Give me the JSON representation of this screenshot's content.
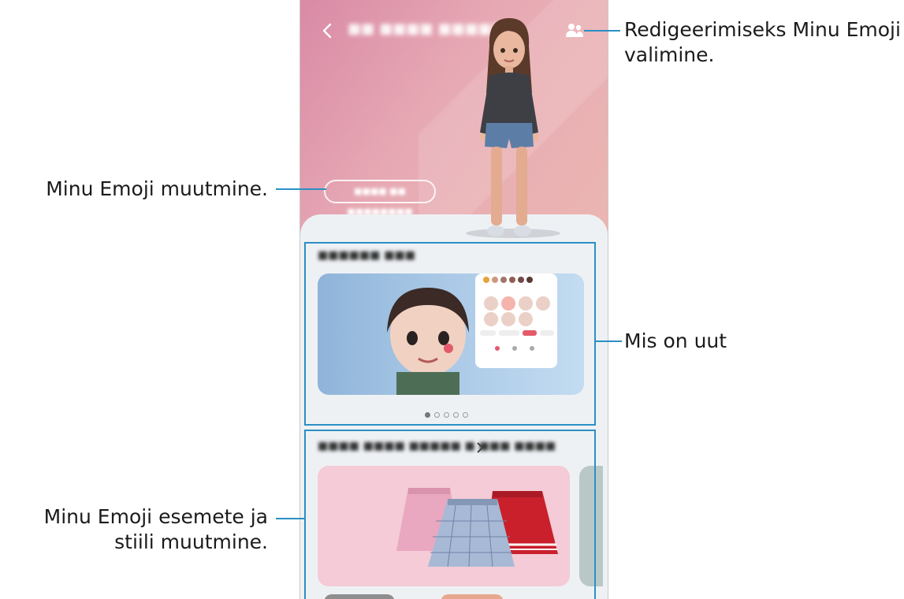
{
  "callouts": {
    "select_emoji": "Redigeerimiseks Minu Emoji valimine.",
    "change_emoji": "Minu Emoji muutmine.",
    "whats_new": "Mis on uut",
    "items_style": "Minu Emoji esemete ja stiili muutmine."
  },
  "icons": {
    "back": "back-arrow-icon",
    "select": "people-icon",
    "next": "chevron-right-icon"
  },
  "colors": {
    "accent": "#2b8fc4",
    "hero_start": "#d98aa6",
    "hero_end": "#ebb6b2"
  },
  "carousel": {
    "pages": 5,
    "active_page": 1
  }
}
